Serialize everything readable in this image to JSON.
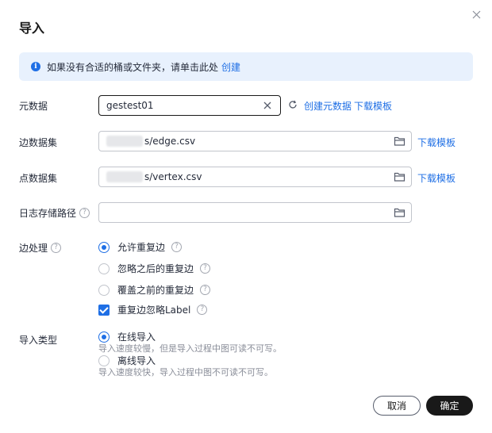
{
  "dialog": {
    "title": "导入",
    "close_icon": "close-icon"
  },
  "info": {
    "text": "如果没有合适的桶或文件夹，请单击此处",
    "link": "创建"
  },
  "metadata": {
    "label": "元数据",
    "value": "gestest01",
    "create_link": "创建元数据",
    "download_link": "下载模板"
  },
  "edge_dataset": {
    "label": "边数据集",
    "value_suffix": "s/edge.csv",
    "download_link": "下载模板"
  },
  "vertex_dataset": {
    "label": "点数据集",
    "value_suffix": "s/vertex.csv",
    "download_link": "下载模板"
  },
  "log_path": {
    "label": "日志存储路径",
    "value": ""
  },
  "edge_handling": {
    "label": "边处理",
    "options": [
      {
        "label": "允许重复边",
        "selected": true
      },
      {
        "label": "忽略之后的重复边",
        "selected": false
      },
      {
        "label": "覆盖之前的重复边",
        "selected": false
      }
    ],
    "ignore_label_checkbox": {
      "label": "重复边忽略Label",
      "checked": true
    }
  },
  "import_type": {
    "label": "导入类型",
    "options": [
      {
        "label": "在线导入",
        "desc": "导入速度较慢，但是导入过程中图可读不可写。",
        "selected": true
      },
      {
        "label": "离线导入",
        "desc": "导入速度较快，导入过程中图不可读不可写。",
        "selected": false
      }
    ]
  },
  "footer": {
    "cancel": "取消",
    "confirm": "确定"
  },
  "colors": {
    "accent": "#1f6fe5",
    "info_bg": "#e8f1fd",
    "primary_button": "#191919"
  }
}
